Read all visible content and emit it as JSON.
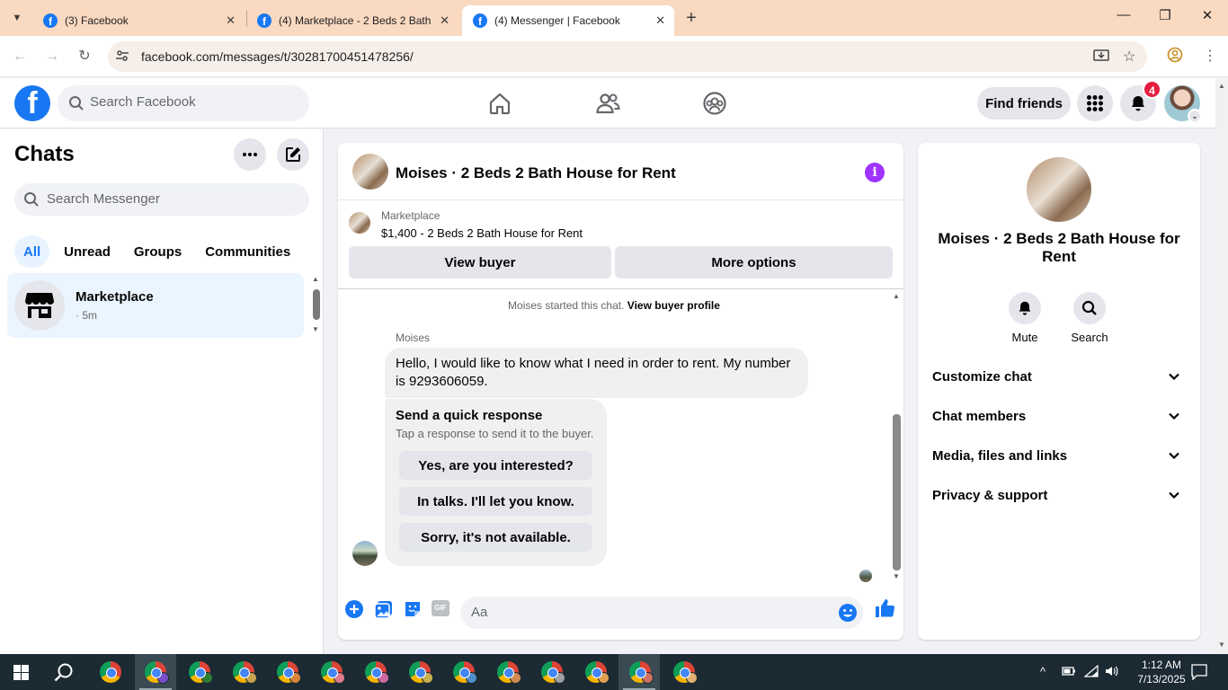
{
  "browser": {
    "tabs": [
      {
        "title": "(3) Facebook",
        "active": false
      },
      {
        "title": "(4) Marketplace - 2 Beds 2 Bath",
        "active": false
      },
      {
        "title": "(4) Messenger | Facebook",
        "active": true
      }
    ],
    "url": "facebook.com/messages/t/30281700451478256/"
  },
  "fb_header": {
    "search_placeholder": "Search Facebook",
    "find_friends": "Find friends",
    "notification_count": "4"
  },
  "chats": {
    "title": "Chats",
    "search_placeholder": "Search Messenger",
    "filters": [
      "All",
      "Unread",
      "Groups",
      "Communities"
    ],
    "items": [
      {
        "name": "Marketplace",
        "meta": "· 5m"
      }
    ]
  },
  "conversation": {
    "title": "Moises · 2 Beds 2 Bath House for Rent",
    "marketplace_label": "Marketplace",
    "listing": "$1,400 - 2 Beds 2 Bath House for Rent",
    "view_buyer": "View buyer",
    "more_options": "More options",
    "system_message": "Moises started this chat.",
    "view_buyer_profile": "View buyer profile",
    "sender": "Moises",
    "message": "Hello, I would like to know what I need in order to rent. My number is 9293606059.",
    "quick_response": {
      "title": "Send a quick response",
      "subtitle": "Tap a response to send it to the buyer.",
      "options": [
        "Yes, are you interested?",
        "In talks. I'll let you know.",
        "Sorry, it's not available."
      ]
    },
    "composer_placeholder": "Aa",
    "gif_label": "GIF"
  },
  "info_panel": {
    "name": "Moises · 2 Beds 2 Bath House for Rent",
    "mute": "Mute",
    "search": "Search",
    "sections": [
      "Customize chat",
      "Chat members",
      "Media, files and links",
      "Privacy & support"
    ]
  },
  "taskbar": {
    "time": "1:12 AM",
    "date": "7/13/2025"
  },
  "colors": {
    "fb_blue": "#1877f2",
    "messenger_purple": "#a033ff",
    "tabbar": "#f9d9c0",
    "notification_red": "#e41e3f"
  }
}
